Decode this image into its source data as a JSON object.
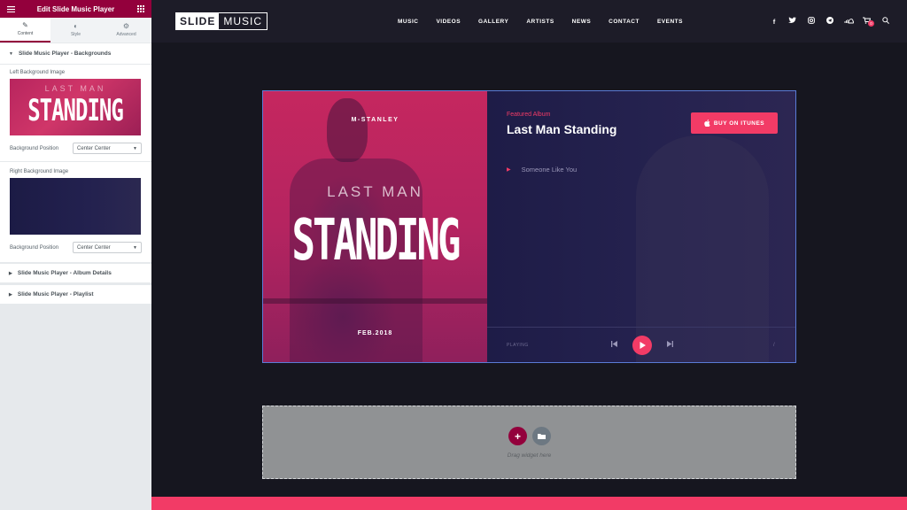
{
  "panel": {
    "title": "Edit Slide Music Player",
    "menu_icon": "hamburger-icon",
    "grid_icon": "apps-grid-icon",
    "tabs": [
      {
        "label": "Content",
        "icon": "pencil-icon"
      },
      {
        "label": "Style",
        "icon": "half-circle-icon"
      },
      {
        "label": "Advanced",
        "icon": "gear-icon"
      }
    ],
    "sections": {
      "backgrounds": "Slide Music Player - Backgrounds",
      "album_details": "Slide Music Player - Album Details",
      "playlist": "Slide Music Player - Playlist"
    },
    "left_bg_label": "Left Background Image",
    "right_bg_label": "Right Background Image",
    "bg_position_label": "Background Position",
    "left_bg_position": "Center Center",
    "right_bg_position": "Center Center",
    "thumb_small_text": "LAST MAN",
    "thumb_big_text": "STANDING"
  },
  "site": {
    "logo_part1": "SLIDE",
    "logo_part2": "MUSIC",
    "nav": [
      "MUSIC",
      "VIDEOS",
      "GALLERY",
      "ARTISTS",
      "NEWS",
      "CONTACT",
      "EVENTS"
    ],
    "social_icons": [
      "facebook-icon",
      "twitter-icon",
      "instagram-icon",
      "telegram-icon",
      "soundcloud-icon",
      "cart-icon"
    ],
    "cart_count": "0"
  },
  "player": {
    "artist": "M-STANLEY",
    "cover_line1": "LAST MAN",
    "cover_line2": "STANDING",
    "release": "FEB.2018",
    "featured_label": "Featured Album",
    "album_title": "Last Man Standing",
    "itunes_button": "BUY ON ITUNES",
    "tracks": [
      "Someone Like You"
    ],
    "playing_label": "PLAYING",
    "slash": "/"
  },
  "dropzone": {
    "text": "Drag widget here"
  },
  "colors": {
    "accent": "#f23b66",
    "editor_brand": "#93003c",
    "player_bg": "#1e1c47"
  }
}
